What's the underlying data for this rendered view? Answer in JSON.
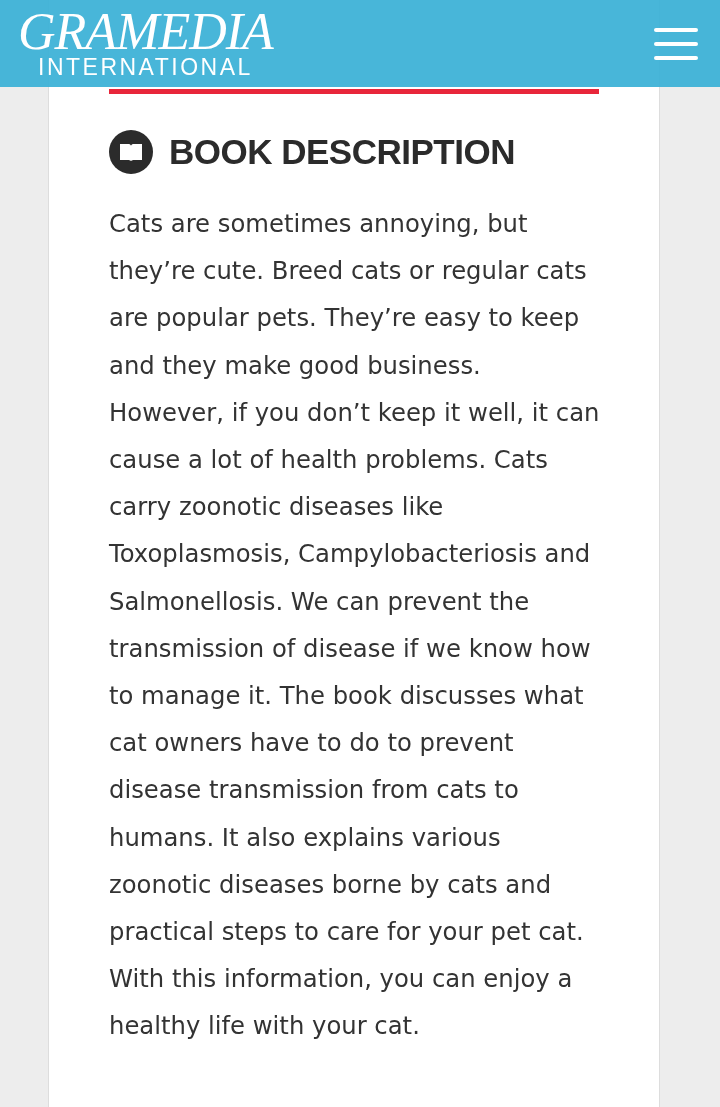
{
  "header": {
    "logo_title": "GRAMEDIA",
    "logo_subtitle": "INTERNATIONAL"
  },
  "section": {
    "heading": "BOOK DESCRIPTION",
    "text": "Cats are sometimes annoying, but they’re cute. Breed cats or regular cats are popular pets. They’re easy to keep and they make good business. However, if you don’t keep it well, it can cause a lot of health problems. Cats carry zoonotic diseases like Toxoplasmosis, Campylobacteriosis and Salmonellosis. We can prevent the transmission of disease if we know how to manage it. The book discusses what cat owners have to do to prevent disease transmission from cats to humans. It also explains various zoonotic diseases borne by cats and practical steps to care for your pet cat. With this information, you can enjoy a healthy life with your cat."
  }
}
